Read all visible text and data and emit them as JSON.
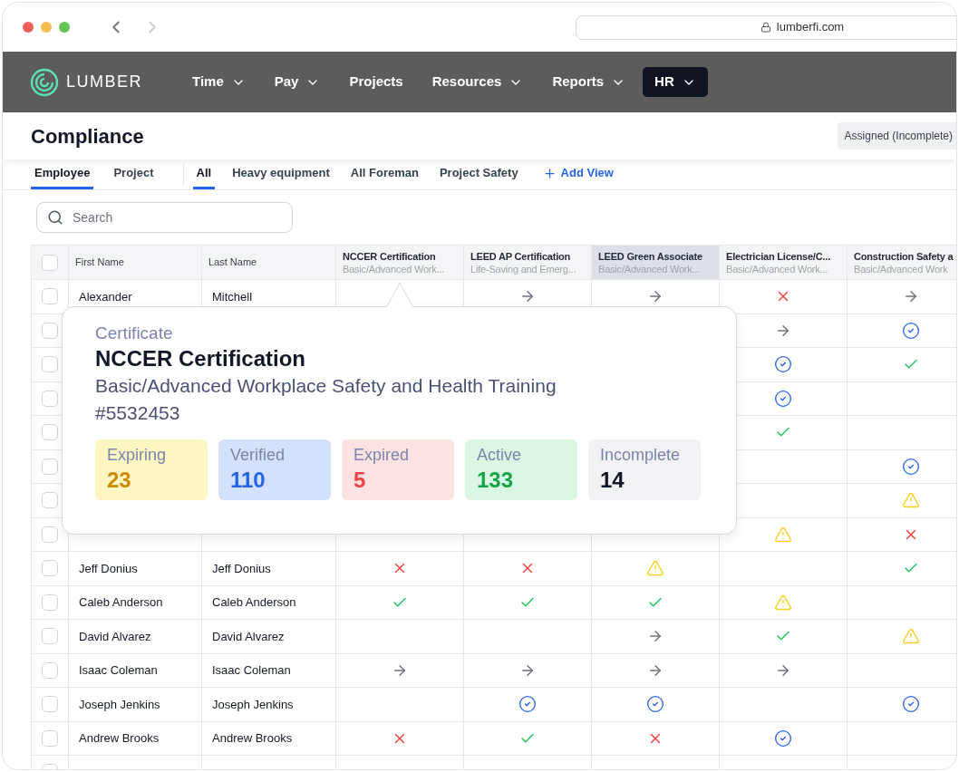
{
  "browser": {
    "url": "lumberfi.com"
  },
  "nav": {
    "brand": "LUMBER",
    "items": [
      {
        "label": "Time",
        "dropdown": true,
        "selected": false
      },
      {
        "label": "Pay",
        "dropdown": true,
        "selected": false
      },
      {
        "label": "Projects",
        "dropdown": false,
        "selected": false
      },
      {
        "label": "Resources",
        "dropdown": true,
        "selected": false
      },
      {
        "label": "Reports",
        "dropdown": true,
        "selected": false
      },
      {
        "label": "HR",
        "dropdown": true,
        "selected": true
      }
    ]
  },
  "page": {
    "title": "Compliance",
    "filter_chip": "Assigned (Incomplete)"
  },
  "view_tabs": [
    {
      "label": "Employee",
      "selected": true
    },
    {
      "label": "Project",
      "selected": false
    }
  ],
  "saved_views": [
    {
      "label": "All",
      "selected": true
    },
    {
      "label": "Heavy equipment",
      "selected": false
    },
    {
      "label": "All Foreman",
      "selected": false
    },
    {
      "label": "Project Safety",
      "selected": false
    }
  ],
  "add_view": "Add View",
  "search": {
    "placeholder": "Search"
  },
  "table": {
    "select_all_checked": false,
    "name_columns": [
      "First Name",
      "Last Name"
    ],
    "cert_columns": [
      {
        "title": "NCCER Certification",
        "subtitle": "Basic/Advanced Work...",
        "hovered": false
      },
      {
        "title": "LEED AP Certification",
        "subtitle": "Life-Saving and Emerg...",
        "hovered": false
      },
      {
        "title": "LEED Green Associate",
        "subtitle": "Basic/Advanced Work...",
        "hovered": true
      },
      {
        "title": "Electrician License/C...",
        "subtitle": "Basic/Advanced Work...",
        "hovered": false
      },
      {
        "title": "Construction Safety a",
        "subtitle": "Basic/Advanced Work",
        "hovered": false
      }
    ],
    "rows": [
      {
        "first": "Alexander",
        "last": "Mitchell",
        "checked": false,
        "cells": [
          null,
          {
            "kind": "arrow"
          },
          {
            "kind": "arrow"
          },
          {
            "kind": "cross"
          },
          {
            "kind": "arrow"
          }
        ]
      },
      {
        "checked": false,
        "cells": [
          null,
          null,
          null,
          {
            "kind": "arrow"
          },
          {
            "kind": "verified"
          }
        ]
      },
      {
        "checked": false,
        "cells": [
          null,
          null,
          null,
          {
            "kind": "verified"
          },
          {
            "kind": "check"
          }
        ]
      },
      {
        "checked": false,
        "cells": [
          null,
          null,
          null,
          {
            "kind": "verified"
          },
          null
        ]
      },
      {
        "checked": false,
        "cells": [
          null,
          null,
          null,
          {
            "kind": "check"
          },
          null
        ]
      },
      {
        "checked": false,
        "cells": [
          null,
          null,
          null,
          null,
          {
            "kind": "verified"
          }
        ]
      },
      {
        "checked": false,
        "cells": [
          null,
          null,
          null,
          null,
          {
            "kind": "warning"
          }
        ]
      },
      {
        "checked": false,
        "cells": [
          null,
          null,
          null,
          {
            "kind": "warning"
          },
          {
            "kind": "cross"
          }
        ]
      },
      {
        "first": "Jeff Donius",
        "last": "Jeff Donius",
        "checked": false,
        "cells": [
          {
            "kind": "cross"
          },
          {
            "kind": "cross"
          },
          {
            "kind": "warning"
          },
          null,
          {
            "kind": "check"
          }
        ]
      },
      {
        "first": "Caleb Anderson",
        "last": "Caleb Anderson",
        "checked": false,
        "cells": [
          {
            "kind": "check"
          },
          {
            "kind": "check"
          },
          {
            "kind": "check"
          },
          {
            "kind": "warning"
          },
          null
        ]
      },
      {
        "first": "David Alvarez",
        "last": "David Alvarez",
        "checked": false,
        "cells": [
          null,
          null,
          {
            "kind": "arrow"
          },
          {
            "kind": "check"
          },
          {
            "kind": "warning"
          }
        ]
      },
      {
        "first": "Isaac Coleman",
        "last": "Isaac Coleman",
        "checked": false,
        "cells": [
          {
            "kind": "arrow"
          },
          {
            "kind": "arrow"
          },
          {
            "kind": "arrow"
          },
          {
            "kind": "arrow"
          },
          null
        ]
      },
      {
        "first": "Joseph Jenkins",
        "last": "Joseph Jenkins",
        "checked": false,
        "cells": [
          null,
          {
            "kind": "verified"
          },
          {
            "kind": "verified"
          },
          null,
          {
            "kind": "verified"
          }
        ]
      },
      {
        "first": "Andrew Brooks",
        "last": "Andrew Brooks",
        "checked": false,
        "cells": [
          {
            "kind": "cross"
          },
          {
            "kind": "check"
          },
          {
            "kind": "cross"
          },
          {
            "kind": "verified"
          },
          null
        ]
      },
      {
        "checked": false,
        "cells": [
          null,
          null,
          null,
          null,
          null
        ]
      }
    ]
  },
  "popover": {
    "label": "Certificate",
    "title": "NCCER Certification",
    "description": "Basic/Advanced Workplace Safety and Health Training",
    "number": "#5532453",
    "stats": [
      {
        "kind": "expiring",
        "label": "Expiring",
        "value": "23"
      },
      {
        "kind": "verified",
        "label": "Verified",
        "value": "110"
      },
      {
        "kind": "expired",
        "label": "Expired",
        "value": "5"
      },
      {
        "kind": "active",
        "label": "Active",
        "value": "133"
      },
      {
        "kind": "incomplete",
        "label": "Incomplete",
        "value": "14"
      }
    ]
  }
}
